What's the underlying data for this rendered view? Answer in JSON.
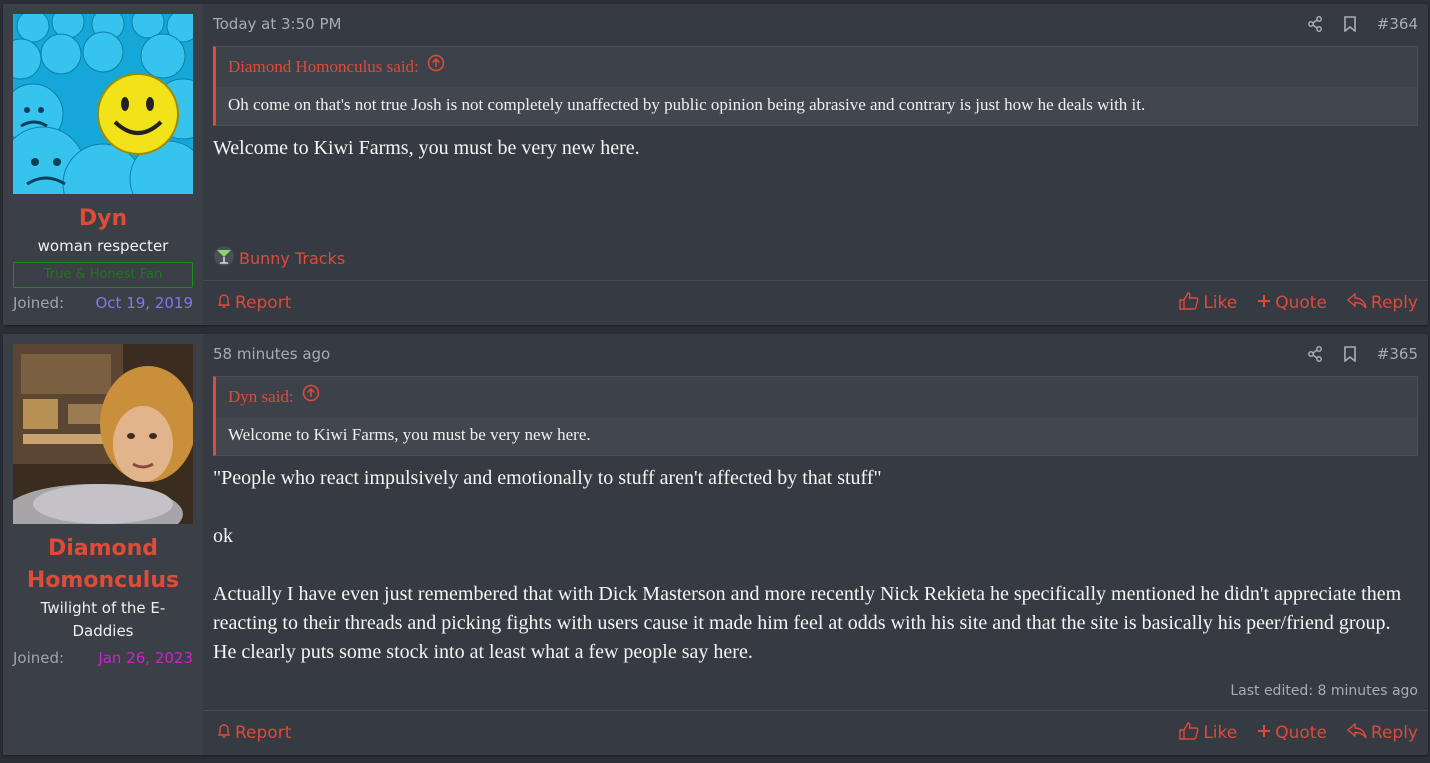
{
  "posts": [
    {
      "user": {
        "name": "Dyn",
        "title": "woman respecter",
        "banner": "True & Honest Fan",
        "joined_label": "Joined:",
        "joined_date": "Oct 19, 2019",
        "joined_color": "#7b7bf0"
      },
      "time": "Today at 3:50 PM",
      "number": "#364",
      "quote": {
        "author": "Diamond Homonculus said:",
        "text": "Oh come on that's not true Josh is not completely unaffected by public opinion being abrasive and contrary is just how he deals with it."
      },
      "body": [
        "Welcome to Kiwi Farms, you must be very new here."
      ],
      "signature": "Bunny Tracks",
      "actions": {
        "report": "Report",
        "like": "Like",
        "quote": "Quote",
        "reply": "Reply"
      }
    },
    {
      "user": {
        "name": "Diamond Homonculus",
        "title": "Twilight of the E-Daddies",
        "joined_label": "Joined:",
        "joined_date": "Jan 26, 2023",
        "joined_color": "#d21fd2"
      },
      "time": "58 minutes ago",
      "number": "#365",
      "quote": {
        "author": "Dyn said:",
        "text": "Welcome to Kiwi Farms, you must be very new here."
      },
      "body": [
        "\"People who react impulsively and emotionally to stuff aren't affected by that stuff\"",
        "ok",
        "Actually I have even just remembered that with Dick Masterson and more recently Nick Rekieta he specifically mentioned he didn't appreciate them reacting to their threads and picking fights with users cause it made him feel at odds with his site and that the site is basically his peer/friend group. He clearly puts some stock into at least what a few people say here."
      ],
      "edited": "Last edited: 8 minutes ago",
      "actions": {
        "report": "Report",
        "like": "Like",
        "quote": "Quote",
        "reply": "Reply"
      }
    }
  ],
  "icons": {
    "share": "share-icon",
    "bookmark": "bookmark-icon",
    "quote_jump": "arrow-up-circle-icon",
    "report": "bell-icon",
    "like": "thumbs-up-icon",
    "quote": "plus-icon",
    "reply": "reply-icon",
    "signature": "cocktail-icon"
  },
  "colors": {
    "accent": "#dd4b39",
    "background": "#363a42"
  }
}
